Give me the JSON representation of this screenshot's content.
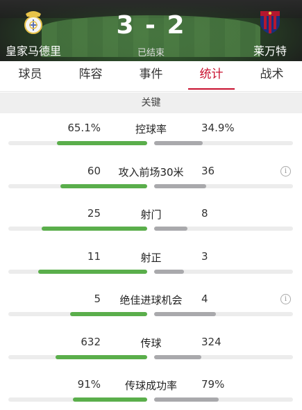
{
  "match": {
    "home_team": "皇家马德里",
    "away_team": "莱万特",
    "score": "3 - 2",
    "status": "已结束"
  },
  "tabs": [
    {
      "label": "球员",
      "active": false
    },
    {
      "label": "阵容",
      "active": false
    },
    {
      "label": "事件",
      "active": false
    },
    {
      "label": "统计",
      "active": true
    },
    {
      "label": "战术",
      "active": false
    }
  ],
  "section_title": "关键",
  "colors": {
    "accent": "#c8102e",
    "home_bar": "#5aae4b",
    "away_bar": "#a9a9ac"
  },
  "stats": [
    {
      "label": "控球率",
      "home": "65.1%",
      "away": "34.9%",
      "home_frac": 0.651,
      "away_frac": 0.349,
      "info": false
    },
    {
      "label": "攻入前场30米",
      "home": "60",
      "away": "36",
      "home_frac": 0.625,
      "away_frac": 0.375,
      "info": true
    },
    {
      "label": "射门",
      "home": "25",
      "away": "8",
      "home_frac": 0.758,
      "away_frac": 0.242,
      "info": false
    },
    {
      "label": "射正",
      "home": "11",
      "away": "3",
      "home_frac": 0.786,
      "away_frac": 0.214,
      "info": false
    },
    {
      "label": "绝佳进球机会",
      "home": "5",
      "away": "4",
      "home_frac": 0.556,
      "away_frac": 0.444,
      "info": true
    },
    {
      "label": "传球",
      "home": "632",
      "away": "324",
      "home_frac": 0.661,
      "away_frac": 0.339,
      "info": false
    },
    {
      "label": "传球成功率",
      "home": "91%",
      "away": "79%",
      "home_frac": 0.535,
      "away_frac": 0.465,
      "info": false
    }
  ]
}
